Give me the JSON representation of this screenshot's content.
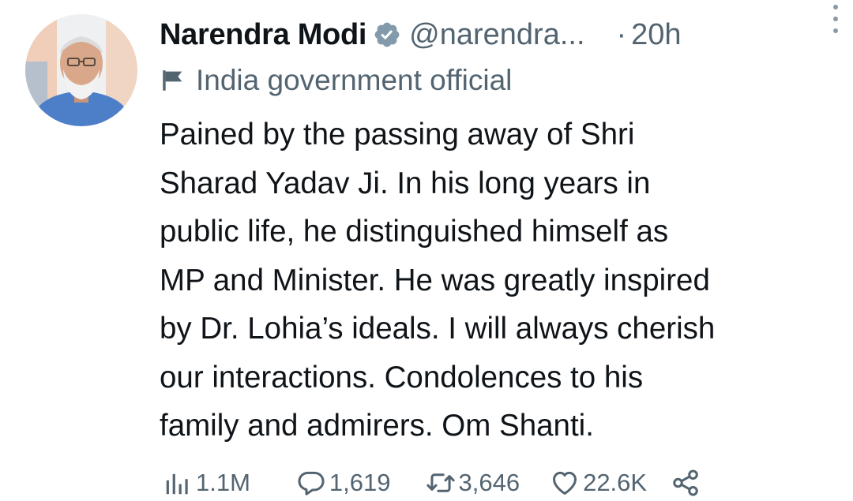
{
  "author": {
    "name": "Narendra Modi",
    "handle": "@narendra...",
    "separator": "·",
    "time": "20h"
  },
  "label": {
    "icon": "flag-icon",
    "text": "India government official"
  },
  "tweet": {
    "lines": [
      "Pained by the passing away of Shri",
      "Sharad Yadav Ji. In his long years in",
      "public life, he distinguished himself as",
      "MP and Minister. He was greatly inspired",
      "by Dr. Lohia’s ideals. I will always cherish",
      "our interactions. Condolences to his",
      "family and admirers. Om Shanti."
    ]
  },
  "actions": {
    "views": "1.1M",
    "replies": "1,619",
    "retweets": "3,646",
    "likes": "22.6K"
  },
  "colors": {
    "text": "#0f1419",
    "secondary": "#536471",
    "verified_badge": "#829aab"
  }
}
